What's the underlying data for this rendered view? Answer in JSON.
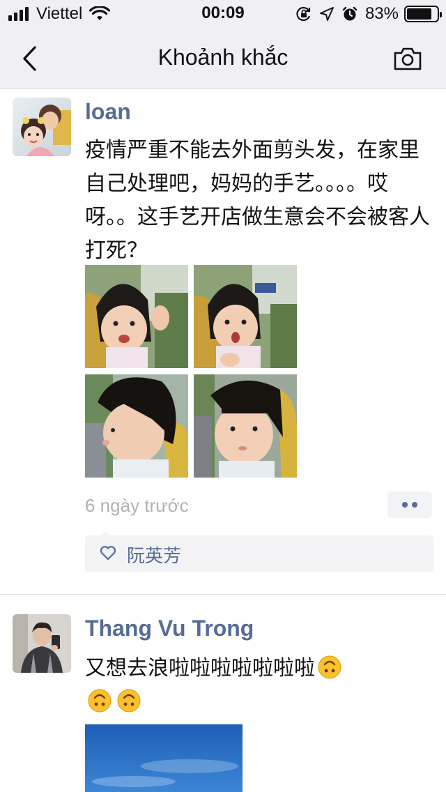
{
  "status_bar": {
    "carrier": "Viettel",
    "time": "00:09",
    "battery_percent": "83%",
    "battery_level": 0.83,
    "icons": [
      "signal-icon",
      "wifi-icon",
      "screen-lock-icon",
      "location-icon",
      "alarm-icon",
      "battery-icon"
    ]
  },
  "nav": {
    "title": "Khoảnh khắc",
    "back_icon": "chevron-left-icon",
    "camera_icon": "camera-icon"
  },
  "posts": [
    {
      "author": "loan",
      "text": "疫情严重不能去外面剪头发，在家里自己处理吧，妈妈的手艺。。。。哎呀。。这手艺开店做生意会不会被客人打死？",
      "photos": [
        "child-photo-1",
        "child-photo-2",
        "child-photo-3",
        "child-photo-4"
      ],
      "timestamp": "6 ngày trước",
      "likes": [
        "阮英芳"
      ]
    },
    {
      "author": "Thang Vu Trong",
      "text": "又想去浪啦啦啦啦啦啦啦",
      "emoji_count": 3,
      "emoji_icon": "upside-down-face-emoji-icon",
      "photos": [
        "sky-photo"
      ]
    }
  ],
  "colors": {
    "link_blue": "#576b95",
    "bar_bg": "#efeff4",
    "muted_text": "#b2b2b2"
  }
}
